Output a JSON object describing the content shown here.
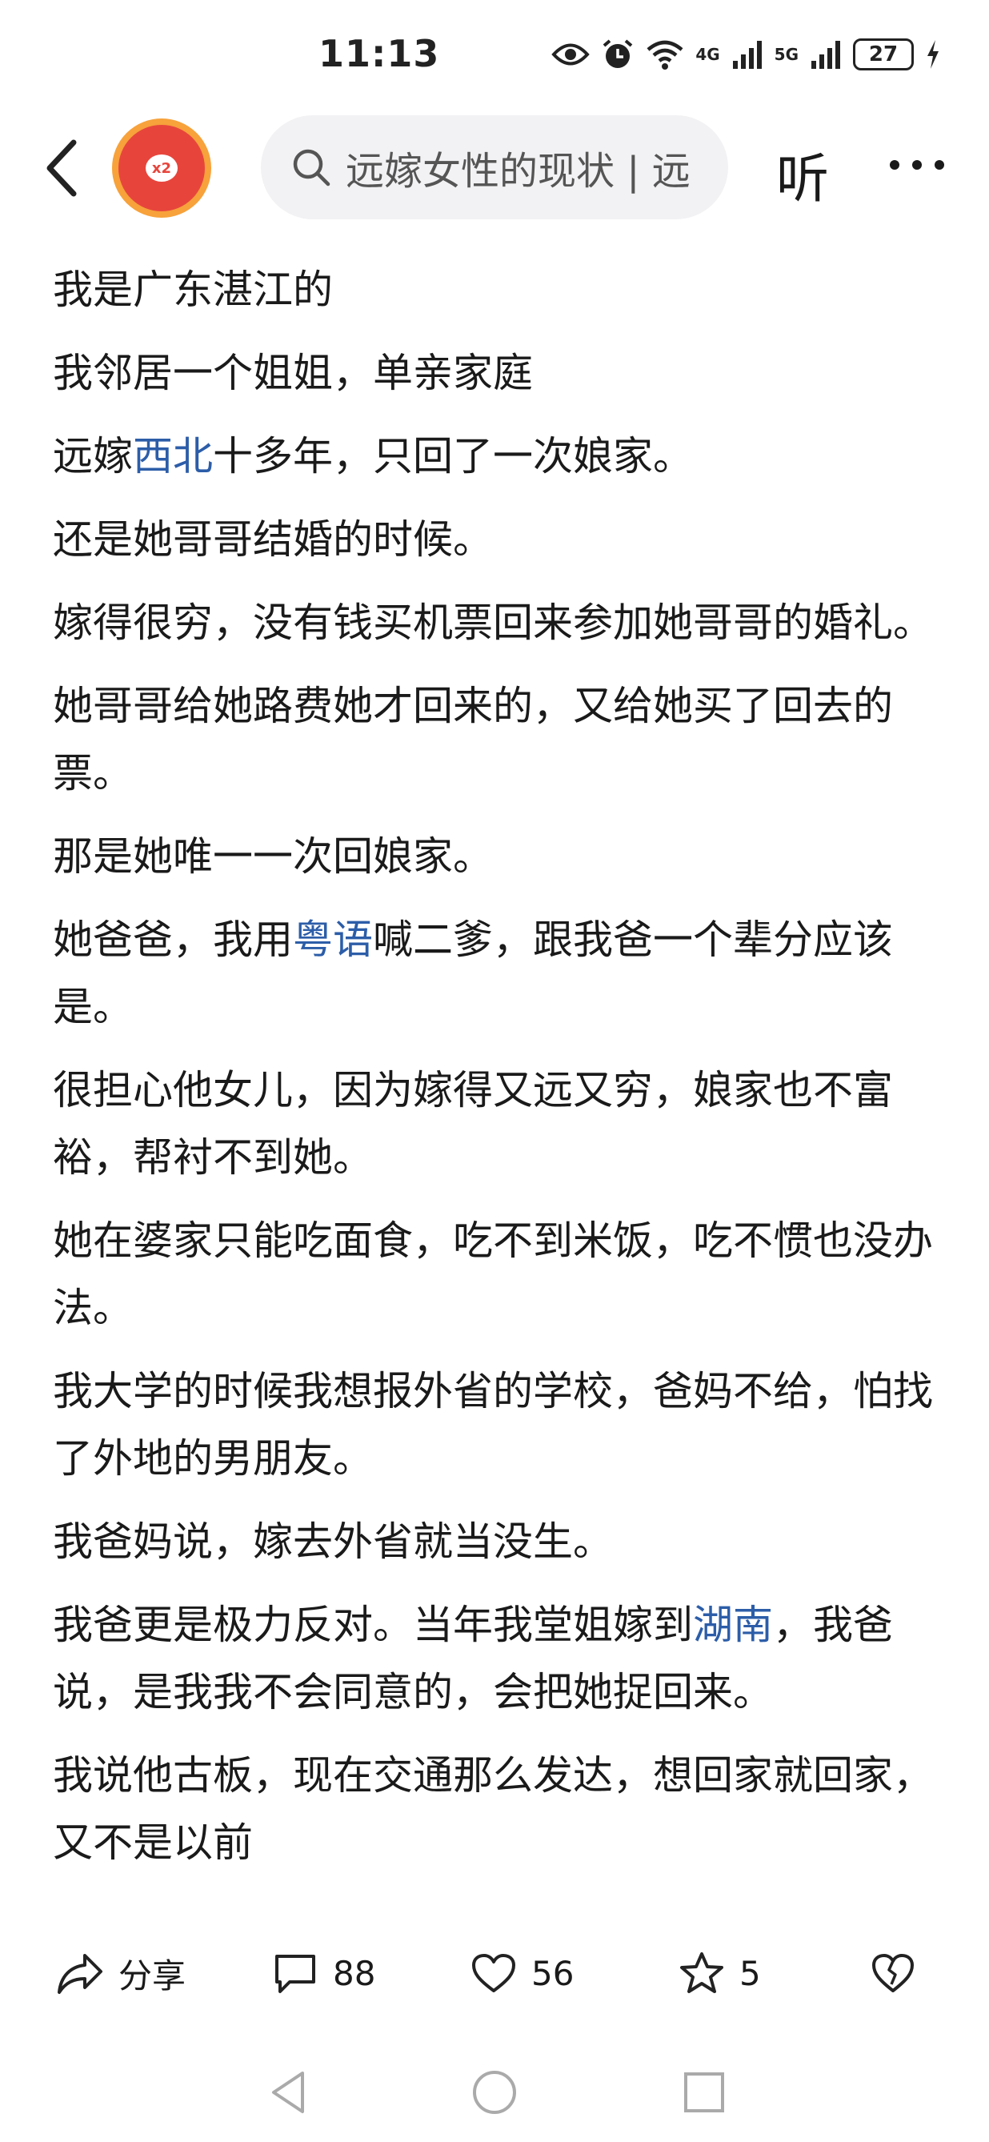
{
  "status_bar": {
    "time": "11:13",
    "network_1": "4G",
    "network_2": "5G",
    "battery": "27"
  },
  "header": {
    "avatar_badge": "x2",
    "search_text": "远嫁女性的现状 | 远",
    "listen_label": "听"
  },
  "article": {
    "paragraphs": [
      [
        {
          "t": "我是广东湛江的"
        }
      ],
      [
        {
          "t": "我邻居一个姐姐，单亲家庭"
        }
      ],
      [
        {
          "t": "远嫁"
        },
        {
          "t": "西北",
          "link": true
        },
        {
          "t": "十多年，只回了一次娘家。"
        }
      ],
      [
        {
          "t": "还是她哥哥结婚的时候。"
        }
      ],
      [
        {
          "t": "嫁得很穷，没有钱买机票回来参加她哥哥的婚礼。"
        }
      ],
      [
        {
          "t": "她哥哥给她路费她才回来的，又给她买了回去的票。"
        }
      ],
      [
        {
          "t": "那是她唯一一次回娘家。"
        }
      ],
      [
        {
          "t": "她爸爸，我用"
        },
        {
          "t": "粤语",
          "link": true
        },
        {
          "t": "喊二爹，跟我爸一个辈分应该是。"
        }
      ],
      [
        {
          "t": "很担心他女儿，因为嫁得又远又穷，娘家也不富裕，帮衬不到她。"
        }
      ],
      [
        {
          "t": "她在婆家只能吃面食，吃不到米饭，吃不惯也没办法。"
        }
      ],
      [
        {
          "t": "我大学的时候我想报外省的学校，爸妈不给，怕找了外地的男朋友。"
        }
      ],
      [
        {
          "t": "我爸妈说，嫁去外省就当没生。"
        }
      ],
      [
        {
          "t": "我爸更是极力反对。当年我堂姐嫁到"
        },
        {
          "t": "湖南",
          "link": true
        },
        {
          "t": "，我爸说，是我我不会同意的，会把她捉回来。"
        }
      ],
      [
        {
          "t": "我说他古板，现在交通那么发达，想回家就回家，又不是以前"
        }
      ]
    ]
  },
  "actions": {
    "share_label": "分享",
    "comment_count": "88",
    "like_count": "56",
    "favorite_count": "5"
  },
  "colors": {
    "link": "#2c5da8",
    "avatar_ring": "#f7a23b",
    "avatar_fill": "#e7453c"
  }
}
